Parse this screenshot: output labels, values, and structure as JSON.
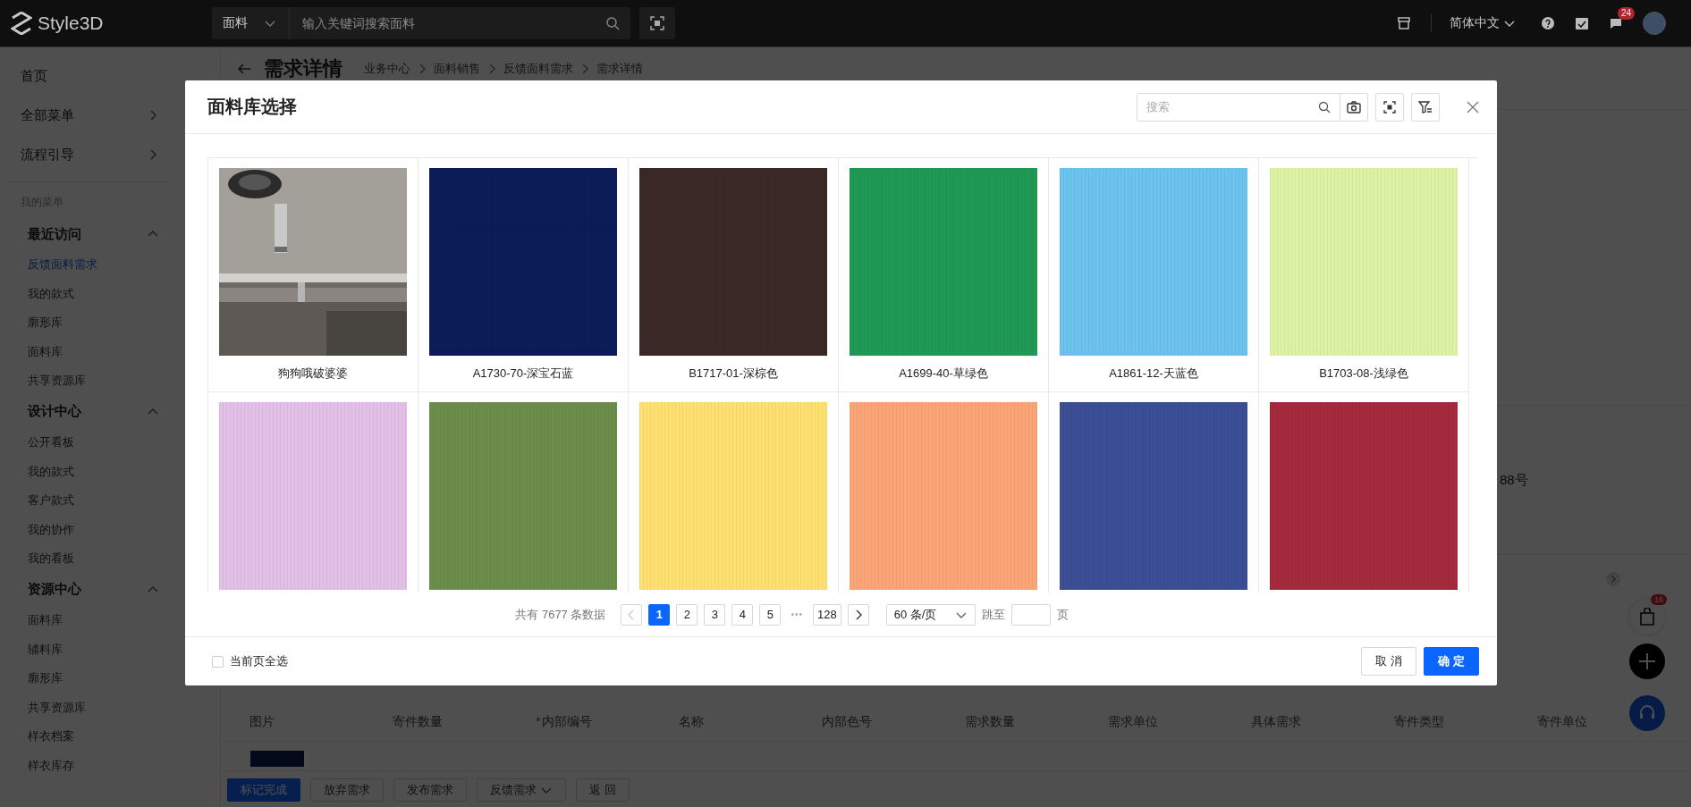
{
  "top_bar": {
    "logo": "Style3D",
    "search": {
      "category": "面料",
      "placeholder": "输入关键词搜索面料"
    },
    "language": "简体中文",
    "notification_count": "24"
  },
  "sidebar": {
    "items": [
      {
        "label": "首页",
        "arrow": false
      },
      {
        "label": "全部菜单",
        "arrow": true
      },
      {
        "label": "流程引导",
        "arrow": true
      }
    ],
    "section_title": "我的菜单",
    "groups": [
      {
        "title": "最近访问",
        "expanded": true,
        "items": [
          {
            "label": "反馈面料需求",
            "selected": true
          },
          {
            "label": "我的款式",
            "selected": false
          },
          {
            "label": "廓形库",
            "selected": false
          },
          {
            "label": "面料库",
            "selected": false
          },
          {
            "label": "共享资源库",
            "selected": false
          }
        ]
      },
      {
        "title": "设计中心",
        "expanded": true,
        "items": [
          {
            "label": "公开看板",
            "selected": false
          },
          {
            "label": "我的款式",
            "selected": false
          },
          {
            "label": "客户款式",
            "selected": false
          },
          {
            "label": "我的协作",
            "selected": false
          },
          {
            "label": "我的看板",
            "selected": false
          }
        ]
      },
      {
        "title": "资源中心",
        "expanded": true,
        "items": [
          {
            "label": "面料库",
            "selected": false
          },
          {
            "label": "辅料库",
            "selected": false
          },
          {
            "label": "廓形库",
            "selected": false
          },
          {
            "label": "共享资源库",
            "selected": false
          },
          {
            "label": "样衣档案",
            "selected": false
          },
          {
            "label": "样衣库存",
            "selected": false
          }
        ]
      }
    ]
  },
  "page": {
    "title": "需求详情",
    "breadcrumb": [
      "业务中心",
      "面料销售",
      "反馈面料需求",
      "需求详情"
    ],
    "address_fragment": "88号",
    "table": {
      "columns": [
        {
          "label": "图片"
        },
        {
          "label": "寄件数量"
        },
        {
          "label": "内部编号",
          "required_mark": "*"
        },
        {
          "label": "名称"
        },
        {
          "label": "内部色号"
        },
        {
          "label": "需求数量"
        },
        {
          "label": "需求单位"
        },
        {
          "label": "具体需求"
        },
        {
          "label": "寄件类型"
        },
        {
          "label": "寄件单位"
        }
      ]
    },
    "actions": [
      {
        "label": "标记完成",
        "primary": true,
        "dropdown": false
      },
      {
        "label": "放弃需求",
        "primary": false,
        "dropdown": false
      },
      {
        "label": "发布需求",
        "primary": false,
        "dropdown": false
      },
      {
        "label": "反馈需求",
        "primary": false,
        "dropdown": true
      },
      {
        "label": "返 回",
        "primary": false,
        "dropdown": false
      }
    ]
  },
  "modal": {
    "title": "面料库选择",
    "search_placeholder": "搜索",
    "fabrics": [
      {
        "kind": "picture",
        "name": "狗狗哦破婆婆"
      },
      {
        "kind": "swatch",
        "name": "A1730-70-深宝石蓝",
        "color": "#0b1c57"
      },
      {
        "kind": "swatch",
        "name": "B1717-01-深棕色",
        "color": "#3a2826"
      },
      {
        "kind": "swatch",
        "name": "A1699-40-草绿色",
        "color": "#1f9a55"
      },
      {
        "kind": "swatch",
        "name": "A1861-12-天蓝色",
        "color": "#6cc4ee"
      },
      {
        "kind": "swatch",
        "name": "B1703-08-浅绿色",
        "color": "#def2a6"
      },
      {
        "kind": "swatch",
        "color": "#e3c0e8"
      },
      {
        "kind": "swatch",
        "color": "#6b8c4b"
      },
      {
        "kind": "swatch",
        "color": "#fde070"
      },
      {
        "kind": "swatch",
        "color": "#f9a577"
      },
      {
        "kind": "swatch",
        "color": "#3b4e96"
      },
      {
        "kind": "swatch",
        "color": "#a52a3d"
      }
    ],
    "pagination": {
      "total": "共有 7677 条数据",
      "prev_disabled": true,
      "pages": [
        {
          "label": "1",
          "selected": true
        },
        {
          "label": "2",
          "selected": false
        },
        {
          "label": "3",
          "selected": false
        },
        {
          "label": "4",
          "selected": false
        },
        {
          "label": "5",
          "selected": false
        },
        {
          "label": "128",
          "selected": false
        }
      ],
      "ellipsis": "•••",
      "page_size": "60 条/页",
      "jump_label": "跳至",
      "page_suffix": "页"
    },
    "select_all": {
      "label": "当前页全选",
      "checked": false
    },
    "buttons": [
      {
        "label": "取 消",
        "primary": false
      },
      {
        "label": "确 定",
        "primary": true
      }
    ]
  },
  "floating": {
    "cart_count": "16"
  }
}
